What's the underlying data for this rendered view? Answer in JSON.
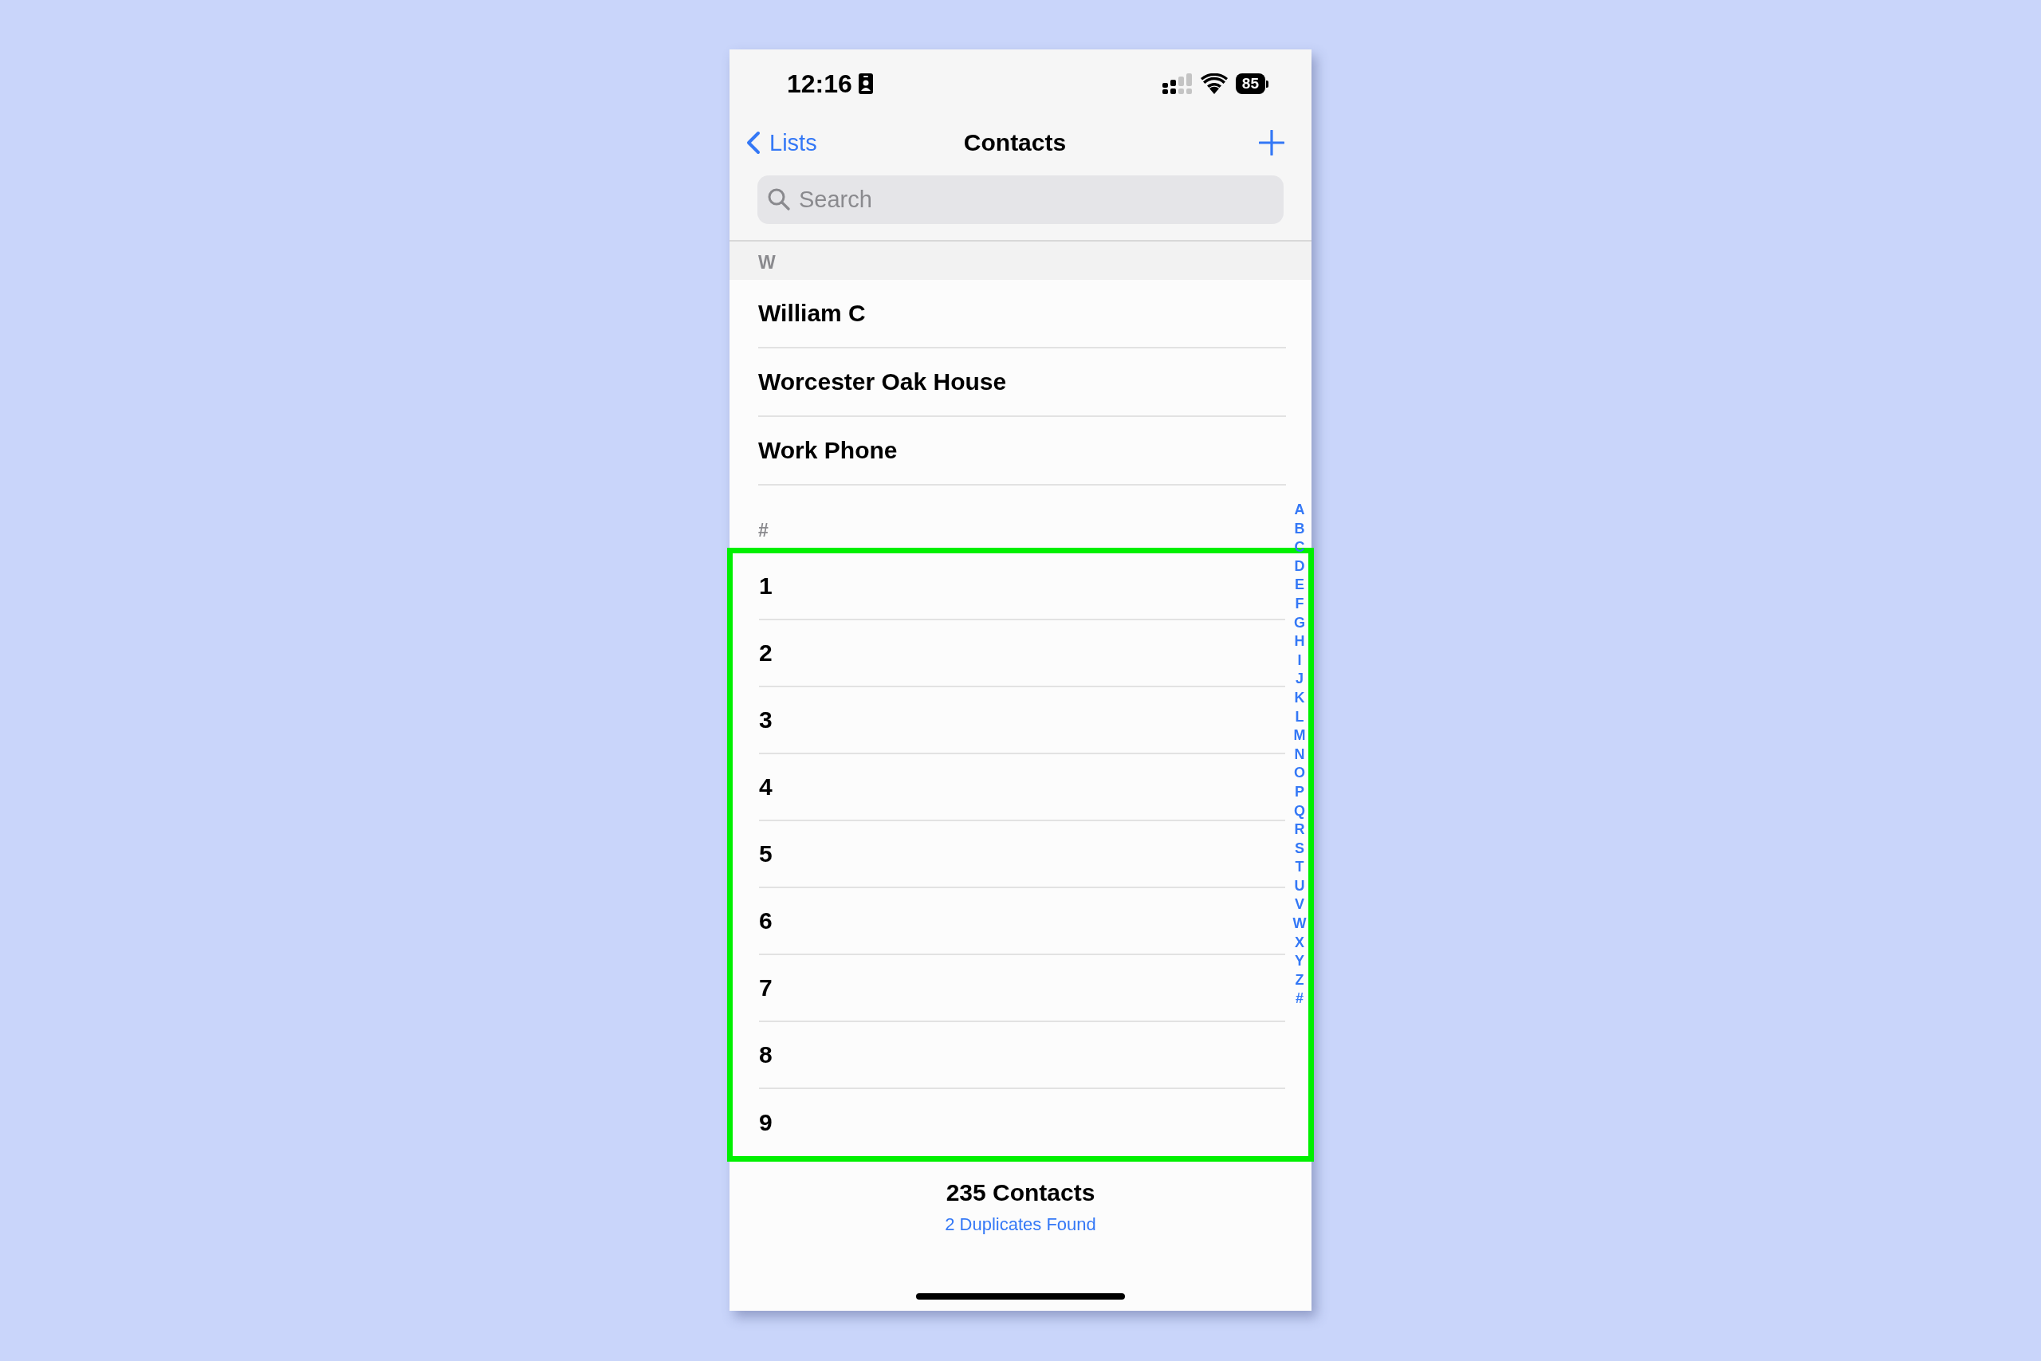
{
  "status_bar": {
    "time": "12:16",
    "battery": "85"
  },
  "nav": {
    "back": "Lists",
    "title": "Contacts"
  },
  "search": {
    "placeholder": "Search"
  },
  "sections": [
    {
      "header": "W",
      "highlighted": false,
      "rows": [
        "William C",
        "Worcester Oak House",
        "Work Phone"
      ]
    },
    {
      "header": "#",
      "highlighted": true,
      "rows": [
        "1",
        "2",
        "3",
        "4",
        "5",
        "6",
        "7",
        "8",
        "9"
      ]
    }
  ],
  "index": [
    "A",
    "B",
    "C",
    "D",
    "E",
    "F",
    "G",
    "H",
    "I",
    "J",
    "K",
    "L",
    "M",
    "N",
    "O",
    "P",
    "Q",
    "R",
    "S",
    "T",
    "U",
    "V",
    "W",
    "X",
    "Y",
    "Z",
    "#"
  ],
  "footer": {
    "count": "235 Contacts",
    "duplicates": "2 Duplicates Found"
  }
}
